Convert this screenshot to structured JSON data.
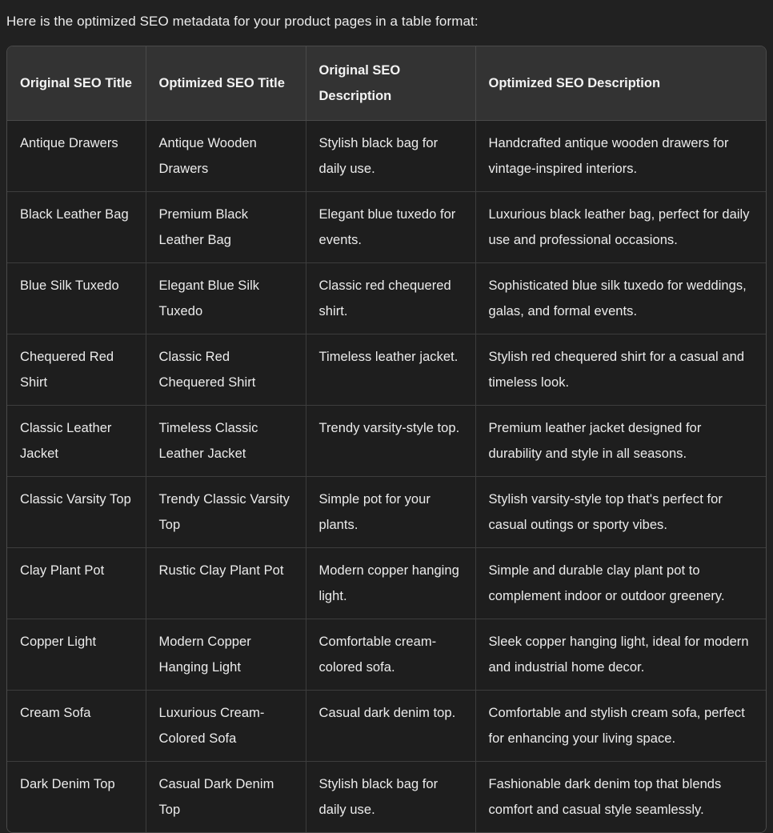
{
  "intro": {
    "text": "Here is the optimized SEO metadata for your product pages in a table format:"
  },
  "table": {
    "columns": [
      "Original SEO Title",
      "Optimized SEO Title",
      "Original SEO Description",
      "Optimized SEO Description"
    ],
    "rows": [
      {
        "original_title": "Antique Drawers",
        "optimized_title": "Antique Wooden Drawers",
        "original_description": "Stylish black bag for daily use.",
        "optimized_description": "Handcrafted antique wooden drawers for vintage-inspired interiors."
      },
      {
        "original_title": "Black Leather Bag",
        "optimized_title": "Premium Black Leather Bag",
        "original_description": "Elegant blue tuxedo for events.",
        "optimized_description": "Luxurious black leather bag, perfect for daily use and professional occasions."
      },
      {
        "original_title": "Blue Silk Tuxedo",
        "optimized_title": "Elegant Blue Silk Tuxedo",
        "original_description": "Classic red chequered shirt.",
        "optimized_description": "Sophisticated blue silk tuxedo for weddings, galas, and formal events."
      },
      {
        "original_title": "Chequered Red Shirt",
        "optimized_title": "Classic Red Chequered Shirt",
        "original_description": "Timeless leather jacket.",
        "optimized_description": "Stylish red chequered shirt for a casual and timeless look."
      },
      {
        "original_title": "Classic Leather Jacket",
        "optimized_title": "Timeless Classic Leather Jacket",
        "original_description": "Trendy varsity-style top.",
        "optimized_description": "Premium leather jacket designed for durability and style in all seasons."
      },
      {
        "original_title": "Classic Varsity Top",
        "optimized_title": "Trendy Classic Varsity Top",
        "original_description": "Simple pot for your plants.",
        "optimized_description": "Stylish varsity-style top that's perfect for casual outings or sporty vibes."
      },
      {
        "original_title": "Clay Plant Pot",
        "optimized_title": "Rustic Clay Plant Pot",
        "original_description": "Modern copper hanging light.",
        "optimized_description": "Simple and durable clay plant pot to complement indoor or outdoor greenery."
      },
      {
        "original_title": "Copper Light",
        "optimized_title": "Modern Copper Hanging Light",
        "original_description": "Comfortable cream-colored sofa.",
        "optimized_description": "Sleek copper hanging light, ideal for modern and industrial home decor."
      },
      {
        "original_title": "Cream Sofa",
        "optimized_title": "Luxurious Cream-Colored Sofa",
        "original_description": "Casual dark denim top.",
        "optimized_description": "Comfortable and stylish cream sofa, perfect for enhancing your living space."
      },
      {
        "original_title": "Dark Denim Top",
        "optimized_title": "Casual Dark Denim Top",
        "original_description": "Stylish black bag for daily use.",
        "optimized_description": "Fashionable dark denim top that blends comfort and casual style seamlessly."
      }
    ]
  },
  "colors": {
    "page_background": "#212121",
    "header_background": "#333333",
    "cell_background": "#1e1e1e",
    "border": "#4a4a4a",
    "text": "#ececec"
  }
}
